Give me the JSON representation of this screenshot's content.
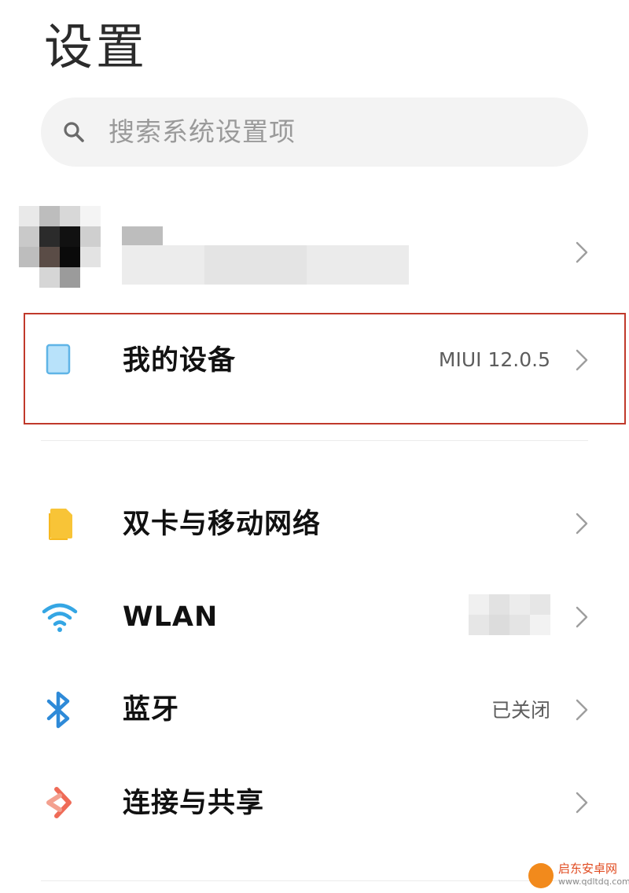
{
  "header": {
    "title": "设置"
  },
  "search": {
    "placeholder": "搜索系统设置项",
    "icon": "search-icon"
  },
  "account": {
    "avatar_icon": "avatar-pixelated",
    "chevron_icon": "chevron-right-icon"
  },
  "my_device": {
    "label": "我的设备",
    "value": "MIUI 12.0.5",
    "icon": "phone-icon",
    "icon_color": "#8fd0f5",
    "highlight_color": "#c0392b"
  },
  "settings_list": [
    {
      "key": "sim",
      "label": "双卡与移动网络",
      "value": "",
      "icon": "sim-card-icon",
      "icon_color": "#f8c437"
    },
    {
      "key": "wlan",
      "label": "WLAN",
      "value": "",
      "icon": "wifi-icon",
      "icon_color": "#35a6e4"
    },
    {
      "key": "bluetooth",
      "label": "蓝牙",
      "value": "已关闭",
      "icon": "bluetooth-icon",
      "icon_color": "#2e8ad8"
    },
    {
      "key": "connect",
      "label": "连接与共享",
      "value": "",
      "icon": "share-icon",
      "icon_color": "#ef6b57"
    }
  ],
  "watermark": {
    "text": "启东安卓网",
    "url": "www.qdltdq.com"
  }
}
